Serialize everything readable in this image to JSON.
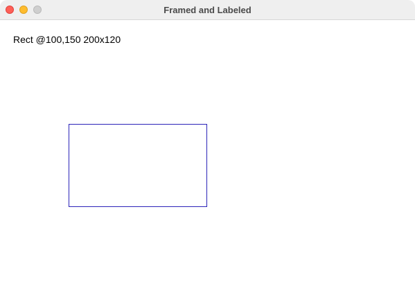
{
  "window": {
    "title": "Framed and Labeled"
  },
  "canvas": {
    "label": "Rect @100,150 200x120",
    "rect_border_color": "#2a22b8"
  },
  "colors": {
    "close": "#fe5f57",
    "minimize": "#febc2e",
    "zoom": "#cfcfcf"
  }
}
